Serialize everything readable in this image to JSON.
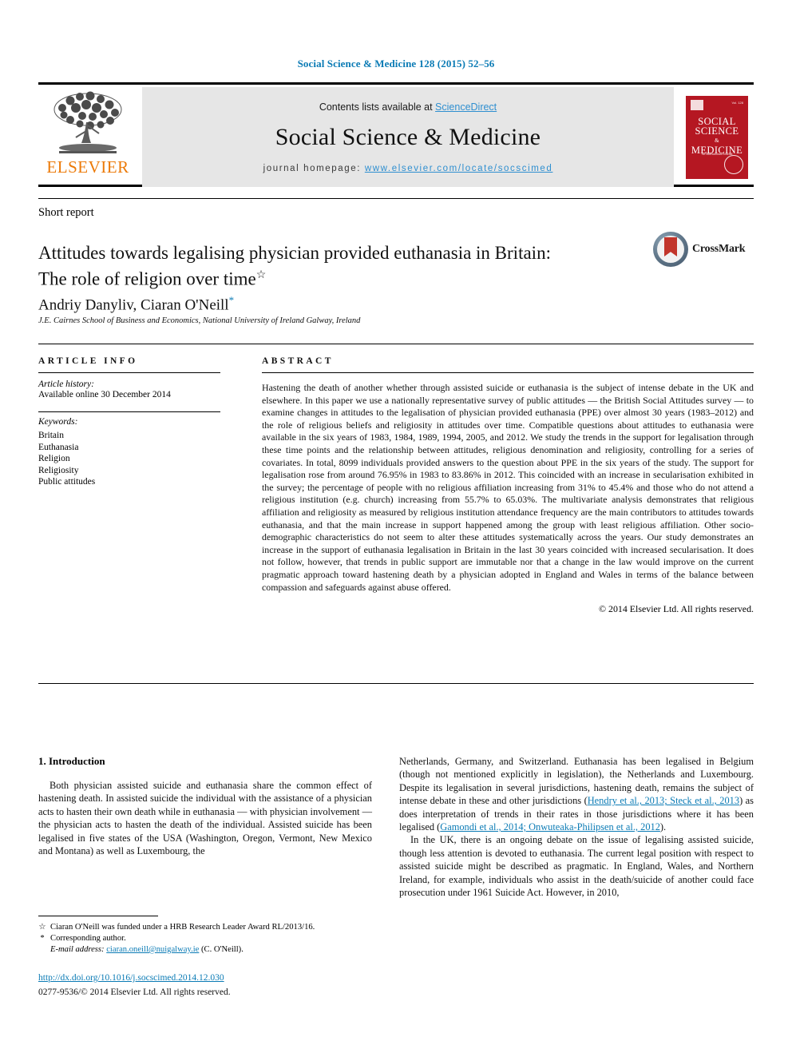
{
  "running_head": "Social Science & Medicine 128 (2015) 52–56",
  "masthead": {
    "publisher_name": "ELSEVIER",
    "contents_prefix": "Contents lists available at ",
    "sciencedirect_link": "ScienceDirect",
    "journal_name": "Social Science & Medicine",
    "homepage_label": "journal homepage: ",
    "homepage_url": "www.elsevier.com/locate/socscimed",
    "cover": {
      "title_line1": "SOCIAL",
      "title_line2": "SCIENCE",
      "amp": "&",
      "title_line3": "MEDICINE",
      "subtitle": "An International Journal",
      "issue_text": "Vol. 128"
    }
  },
  "article": {
    "type_label": "Short report",
    "title_line1": "Attitudes towards legalising physician provided euthanasia in Britain:",
    "title_line2": "The role of religion over time",
    "title_footnote_mark": "☆",
    "crossmark_label": "CrossMark",
    "authors": "Andriy Danyliv, Ciaran O'Neill",
    "author_corr_mark": "*",
    "affiliation": "J.E. Cairnes School of Business and Economics, National University of Ireland Galway, Ireland"
  },
  "article_info": {
    "heading": "ARTICLE INFO",
    "history_label": "Article history:",
    "history_value": "Available online 30 December 2014",
    "keywords_label": "Keywords:",
    "keywords": [
      "Britain",
      "Euthanasia",
      "Religion",
      "Religiosity",
      "Public attitudes"
    ]
  },
  "abstract": {
    "heading": "ABSTRACT",
    "text": "Hastening the death of another whether through assisted suicide or euthanasia is the subject of intense debate in the UK and elsewhere. In this paper we use a nationally representative survey of public attitudes — the British Social Attitudes survey — to examine changes in attitudes to the legalisation of physician provided euthanasia (PPE) over almost 30 years (1983–2012) and the role of religious beliefs and religiosity in attitudes over time. Compatible questions about attitudes to euthanasia were available in the six years of 1983, 1984, 1989, 1994, 2005, and 2012. We study the trends in the support for legalisation through these time points and the relationship between attitudes, religious denomination and religiosity, controlling for a series of covariates. In total, 8099 individuals provided answers to the question about PPE in the six years of the study. The support for legalisation rose from around 76.95% in 1983 to 83.86% in 2012. This coincided with an increase in secularisation exhibited in the survey; the percentage of people with no religious affiliation increasing from 31% to 45.4% and those who do not attend a religious institution (e.g. church) increasing from 55.7% to 65.03%. The multivariate analysis demonstrates that religious affiliation and religiosity as measured by religious institution attendance frequency are the main contributors to attitudes towards euthanasia, and that the main increase in support happened among the group with least religious affiliation. Other socio-demographic characteristics do not seem to alter these attitudes systematically across the years. Our study demonstrates an increase in the support of euthanasia legalisation in Britain in the last 30 years coincided with increased secularisation. It does not follow, however, that trends in public support are immutable nor that a change in the law would improve on the current pragmatic approach toward hastening death by a physician adopted in England and Wales in terms of the balance between compassion and safeguards against abuse offered.",
    "copyright": "© 2014 Elsevier Ltd. All rights reserved."
  },
  "introduction": {
    "section_number_title": "1. Introduction",
    "left_p1": "Both physician assisted suicide and euthanasia share the common effect of hastening death. In assisted suicide the individual with the assistance of a physician acts to hasten their own death while in euthanasia — with physician involvement — the physician acts to hasten the death of the individual. Assisted suicide has been legalised in five states of the USA (Washington, Oregon, Vermont, New Mexico and Montana) as well as Luxembourg, the",
    "right_p1_a": "Netherlands, Germany, and Switzerland. Euthanasia has been legalised in Belgium (though not mentioned explicitly in legislation), the Netherlands and Luxembourg. Despite its legalisation in several jurisdictions, hastening death, remains the subject of intense debate in these and other jurisdictions (",
    "right_p1_cite1": "Hendry et al., 2013; Steck et al., 2013",
    "right_p1_b": ") as does interpretation of trends in their rates in those jurisdictions where it has been legalised (",
    "right_p1_cite2": "Gamondi et al., 2014; Onwuteaka-Philipsen et al., 2012",
    "right_p1_c": ").",
    "right_p2": "In the UK, there is an ongoing debate on the issue of legalising assisted suicide, though less attention is devoted to euthanasia. The current legal position with respect to assisted suicide might be described as pragmatic. In England, Wales, and Northern Ireland, for example, individuals who assist in the death/suicide of another could face prosecution under 1961 Suicide Act. However, in 2010,"
  },
  "footnotes": {
    "star_mark": "☆",
    "star_text": "Ciaran O'Neill was funded under a HRB Research Leader Award RL/2013/16.",
    "corr_mark": "*",
    "corr_text": "Corresponding author.",
    "email_label": "E-mail address:",
    "email": "ciaran.oneill@nuigalway.ie",
    "email_suffix": "(C. O'Neill).",
    "doi": "http://dx.doi.org/10.1016/j.socscimed.2014.12.030",
    "issn_copyright": "0277-9536/© 2014 Elsevier Ltd. All rights reserved."
  },
  "colors": {
    "link_blue": "#0b7bb5",
    "elsevier_orange": "#ec7a08",
    "cover_red": "#b51722",
    "band_grey": "#e6e6e6"
  }
}
